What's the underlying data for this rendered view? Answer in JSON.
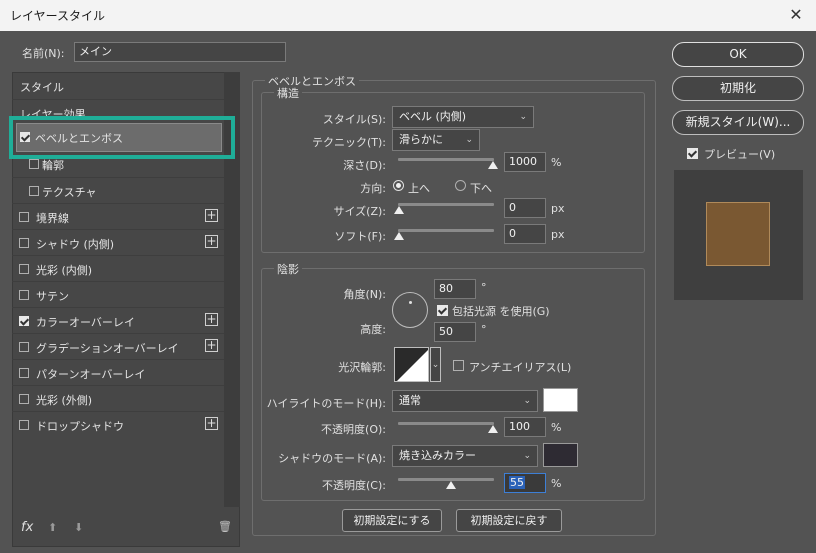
{
  "window": {
    "title": "レイヤースタイル",
    "close_glyph": "✕"
  },
  "name_field": {
    "label": "名前(N):",
    "value": "メイン"
  },
  "left_panel": {
    "style_header": "スタイル",
    "blend_header": "レイヤー効果",
    "items": [
      {
        "label": "ベベルとエンボス",
        "checked": true,
        "plus": false,
        "sub": false
      },
      {
        "label": "輪郭",
        "checked": false,
        "plus": false,
        "sub": true
      },
      {
        "label": "テクスチャ",
        "checked": false,
        "plus": false,
        "sub": true
      },
      {
        "label": "境界線",
        "checked": false,
        "plus": true,
        "sub": false
      },
      {
        "label": "シャドウ (内側)",
        "checked": false,
        "plus": true,
        "sub": false
      },
      {
        "label": "光彩 (内側)",
        "checked": false,
        "plus": false,
        "sub": false
      },
      {
        "label": "サテン",
        "checked": false,
        "plus": false,
        "sub": false
      },
      {
        "label": "カラーオーバーレイ",
        "checked": true,
        "plus": true,
        "sub": false
      },
      {
        "label": "グラデーションオーバーレイ",
        "checked": false,
        "plus": true,
        "sub": false
      },
      {
        "label": "パターンオーバーレイ",
        "checked": false,
        "plus": false,
        "sub": false
      },
      {
        "label": "光彩 (外側)",
        "checked": false,
        "plus": false,
        "sub": false
      },
      {
        "label": "ドロップシャドウ",
        "checked": false,
        "plus": true,
        "sub": false
      }
    ],
    "fx_label": "fx",
    "up_glyph": "⬆",
    "down_glyph": "⬇",
    "trash_glyph": "🗑"
  },
  "bevel": {
    "section_title": "ベベルとエンボス",
    "structure_title": "構造",
    "style_label": "スタイル(S):",
    "style_value": "ベベル (内側)",
    "technique_label": "テクニック(T):",
    "technique_value": "滑らかに",
    "depth_label": "深さ(D):",
    "depth_value": "1000",
    "depth_unit": "%",
    "direction_label": "方向:",
    "direction_up": "上へ",
    "direction_down": "下へ",
    "size_label": "サイズ(Z):",
    "size_value": "0",
    "size_unit": "px",
    "soften_label": "ソフト(F):",
    "soften_value": "0",
    "soften_unit": "px"
  },
  "shading": {
    "title": "陰影",
    "angle_label": "角度(N):",
    "angle_value": "80",
    "angle_unit": "°",
    "global_light_label": "包括光源 を使用(G)",
    "altitude_label": "高度:",
    "altitude_value": "50",
    "altitude_unit": "°",
    "gloss_label": "光沢輪郭:",
    "antialias_label": "アンチエイリアス(L)",
    "highlight_mode_label": "ハイライトのモード(H):",
    "highlight_mode_value": "通常",
    "highlight_opacity_label": "不透明度(O):",
    "highlight_opacity_value": "100",
    "highlight_opacity_unit": "%",
    "shadow_mode_label": "シャドウのモード(A):",
    "shadow_mode_value": "焼き込みカラー",
    "shadow_opacity_label": "不透明度(C):",
    "shadow_opacity_value": "55",
    "shadow_opacity_unit": "%",
    "highlight_color": "#ffffff",
    "shadow_color": "#2e2b33"
  },
  "bottom_buttons": {
    "make_default": "初期設定にする",
    "reset_default": "初期設定に戻す"
  },
  "right_buttons": {
    "ok": "OK",
    "reset": "初期化",
    "new_style": "新規スタイル(W)...",
    "preview_label": "プレビュー(V)"
  },
  "colors": {
    "accent_highlight": "#1fae98",
    "preview_swatch": "#7a5832"
  }
}
